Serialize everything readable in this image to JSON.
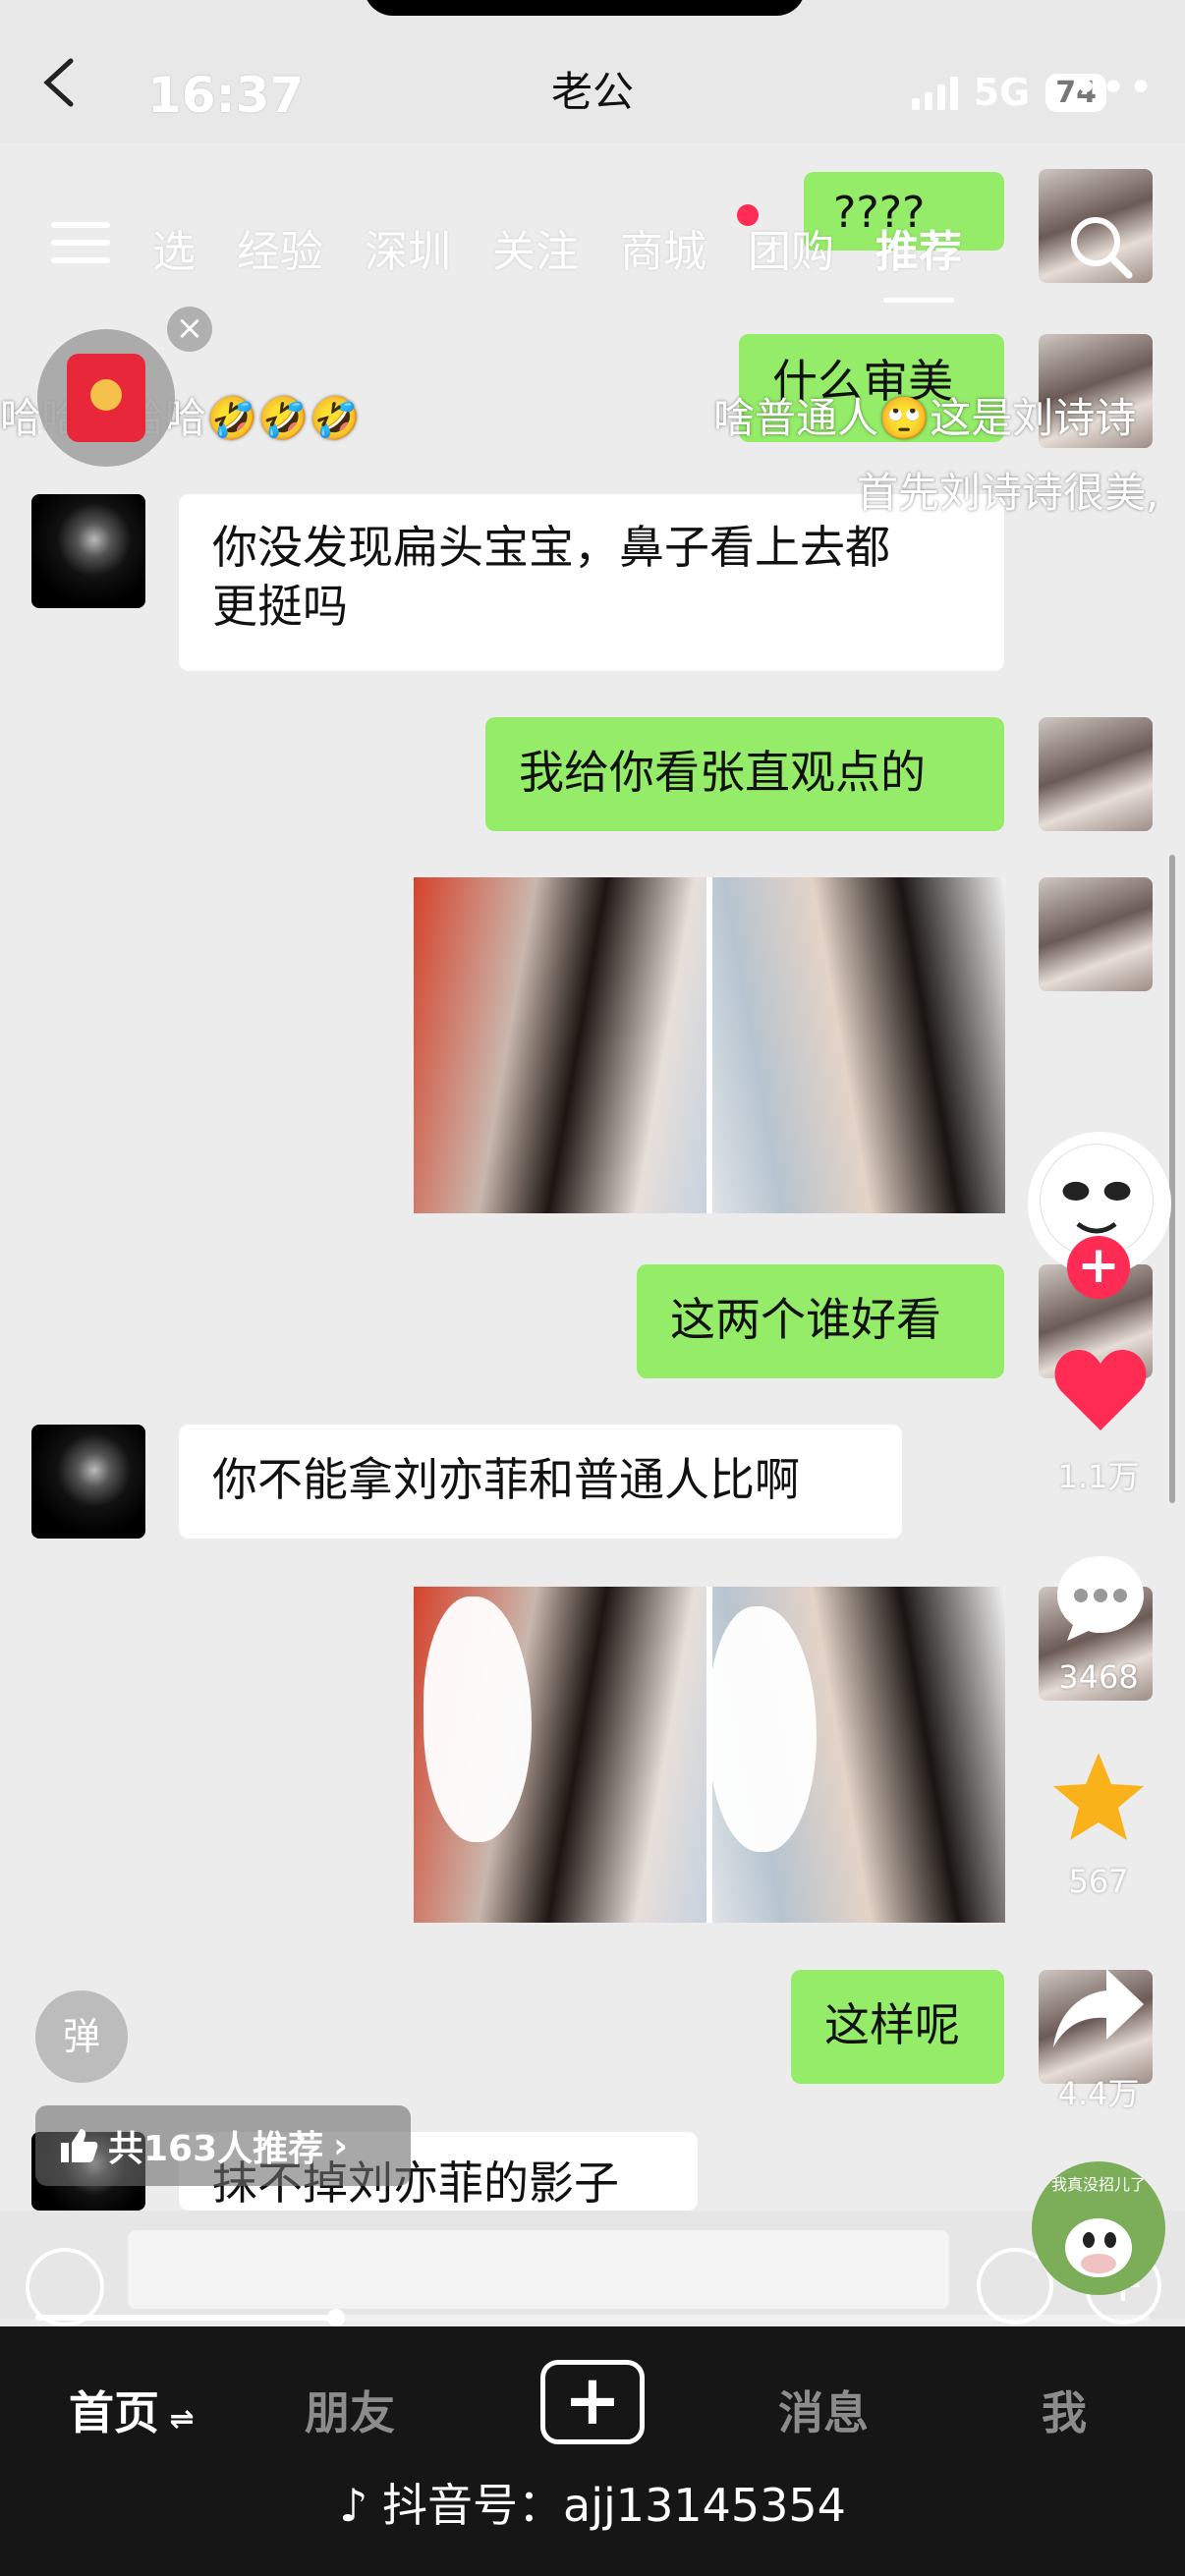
{
  "status": {
    "time": "16:37",
    "network": "5G",
    "battery": "74"
  },
  "header": {
    "title": "老公"
  },
  "nav_tabs": [
    "选",
    "经验",
    "深圳",
    "关注",
    "商城",
    "团购",
    "推荐"
  ],
  "messages": [
    {
      "side": "right",
      "text": "????"
    },
    {
      "side": "right",
      "text": "什么审美"
    },
    {
      "side": "left",
      "text_line1": "你没发现扁头宝宝，鼻子看上去都",
      "text_line2": "更挺吗"
    },
    {
      "side": "right",
      "text": "我给你看张直观点的"
    },
    {
      "side": "right",
      "text": "这两个谁好看"
    },
    {
      "side": "left",
      "text": "你不能拿刘亦菲和普通人比啊"
    },
    {
      "side": "right",
      "text": "这样呢"
    },
    {
      "side": "left",
      "text": "抹不掉刘亦菲的影子"
    }
  ],
  "danmaku": {
    "line1_left": "哈哈哈哈哈🤣🤣🤣",
    "line1_right": "啥普通人🙄这是刘诗诗",
    "line2": "首先刘诗诗很美,"
  },
  "actions": {
    "likes": "1.1万",
    "comments": "3468",
    "favorites": "567",
    "shares": "4.4万"
  },
  "overlays": {
    "danmaku_button": "弹",
    "recommend_text": "共163人推荐",
    "sticker_text": "我真没招儿了"
  },
  "progress": {
    "played_fraction": 0.27
  },
  "bottom_nav": {
    "home": "首页",
    "friends": "朋友",
    "messages": "消息",
    "me": "我"
  },
  "footer": {
    "douyin_id": "抖音号：ajj13145354"
  },
  "colors": {
    "accent": "#fe2c55",
    "bubble_green": "#95ec69",
    "star": "#f9b21a"
  }
}
